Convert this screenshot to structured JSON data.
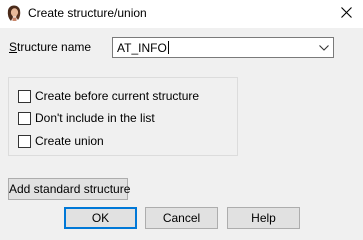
{
  "window": {
    "title": "Create structure/union",
    "app_icon": "ida-icon",
    "close_icon": "close-icon"
  },
  "form": {
    "name_label": "Structure name",
    "name_label_mnemonic": "S",
    "name_label_rest": "tructure name",
    "name_value": "AT_INFO",
    "combo_arrow_icon": "chevron-down-icon"
  },
  "options": [
    {
      "label": "Create before current structure",
      "checked": false
    },
    {
      "label": "Don't include in the list",
      "checked": false
    },
    {
      "label": "Create union",
      "checked": false
    }
  ],
  "buttons": {
    "add_standard": "Add standard structure",
    "ok": "OK",
    "cancel": "Cancel",
    "help": "Help"
  },
  "colors": {
    "dialog_bg": "#f0f0f0",
    "titlebar_bg": "#ffffff",
    "default_button_border": "#0078d7"
  }
}
